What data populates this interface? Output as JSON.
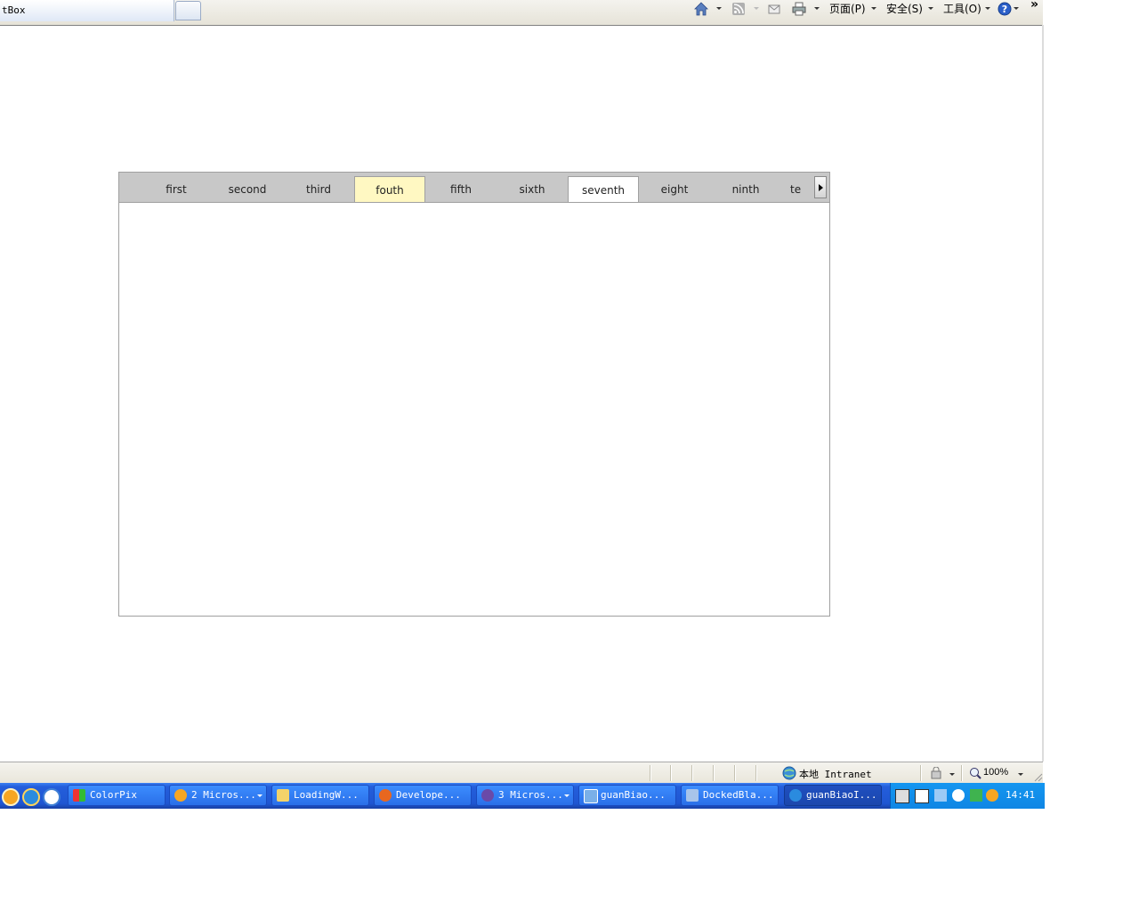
{
  "browser": {
    "tab_title": "tBox",
    "toolbar": {
      "page_menu": "页面(P)",
      "safety_menu": "安全(S)",
      "tools_menu": "工具(O)",
      "more": "»"
    }
  },
  "tab_widget": {
    "tabs": [
      {
        "label": "first",
        "state": "normal"
      },
      {
        "label": "second",
        "state": "normal"
      },
      {
        "label": "third",
        "state": "normal"
      },
      {
        "label": "fouth",
        "state": "hover"
      },
      {
        "label": "fifth",
        "state": "normal"
      },
      {
        "label": "sixth",
        "state": "normal"
      },
      {
        "label": "seventh",
        "state": "selected"
      },
      {
        "label": "eight",
        "state": "normal"
      },
      {
        "label": "ninth",
        "state": "normal"
      },
      {
        "label": "te",
        "state": "normal"
      }
    ],
    "colors": {
      "strip": "#c8c8c8",
      "hover": "#fff8c2",
      "selected": "#ffffff"
    }
  },
  "status_bar": {
    "zone": "本地 Intranet",
    "zoom": "100%"
  },
  "taskbar": {
    "buttons": [
      {
        "label": "ColorPix",
        "icon": "colorpix-icon"
      },
      {
        "label": "2 Micros...",
        "icon": "chat-icon"
      },
      {
        "label": "LoadingW...",
        "icon": "folder-icon"
      },
      {
        "label": "Develope...",
        "icon": "firefox-icon"
      },
      {
        "label": "3 Micros...",
        "icon": "visual-studio-icon"
      },
      {
        "label": "guanBiao...",
        "icon": "editor-icon"
      },
      {
        "label": "DockedBla...",
        "icon": "puzzle-icon"
      },
      {
        "label": "guanBiaoI...",
        "icon": "ie-icon"
      }
    ],
    "clock": "14:41"
  }
}
